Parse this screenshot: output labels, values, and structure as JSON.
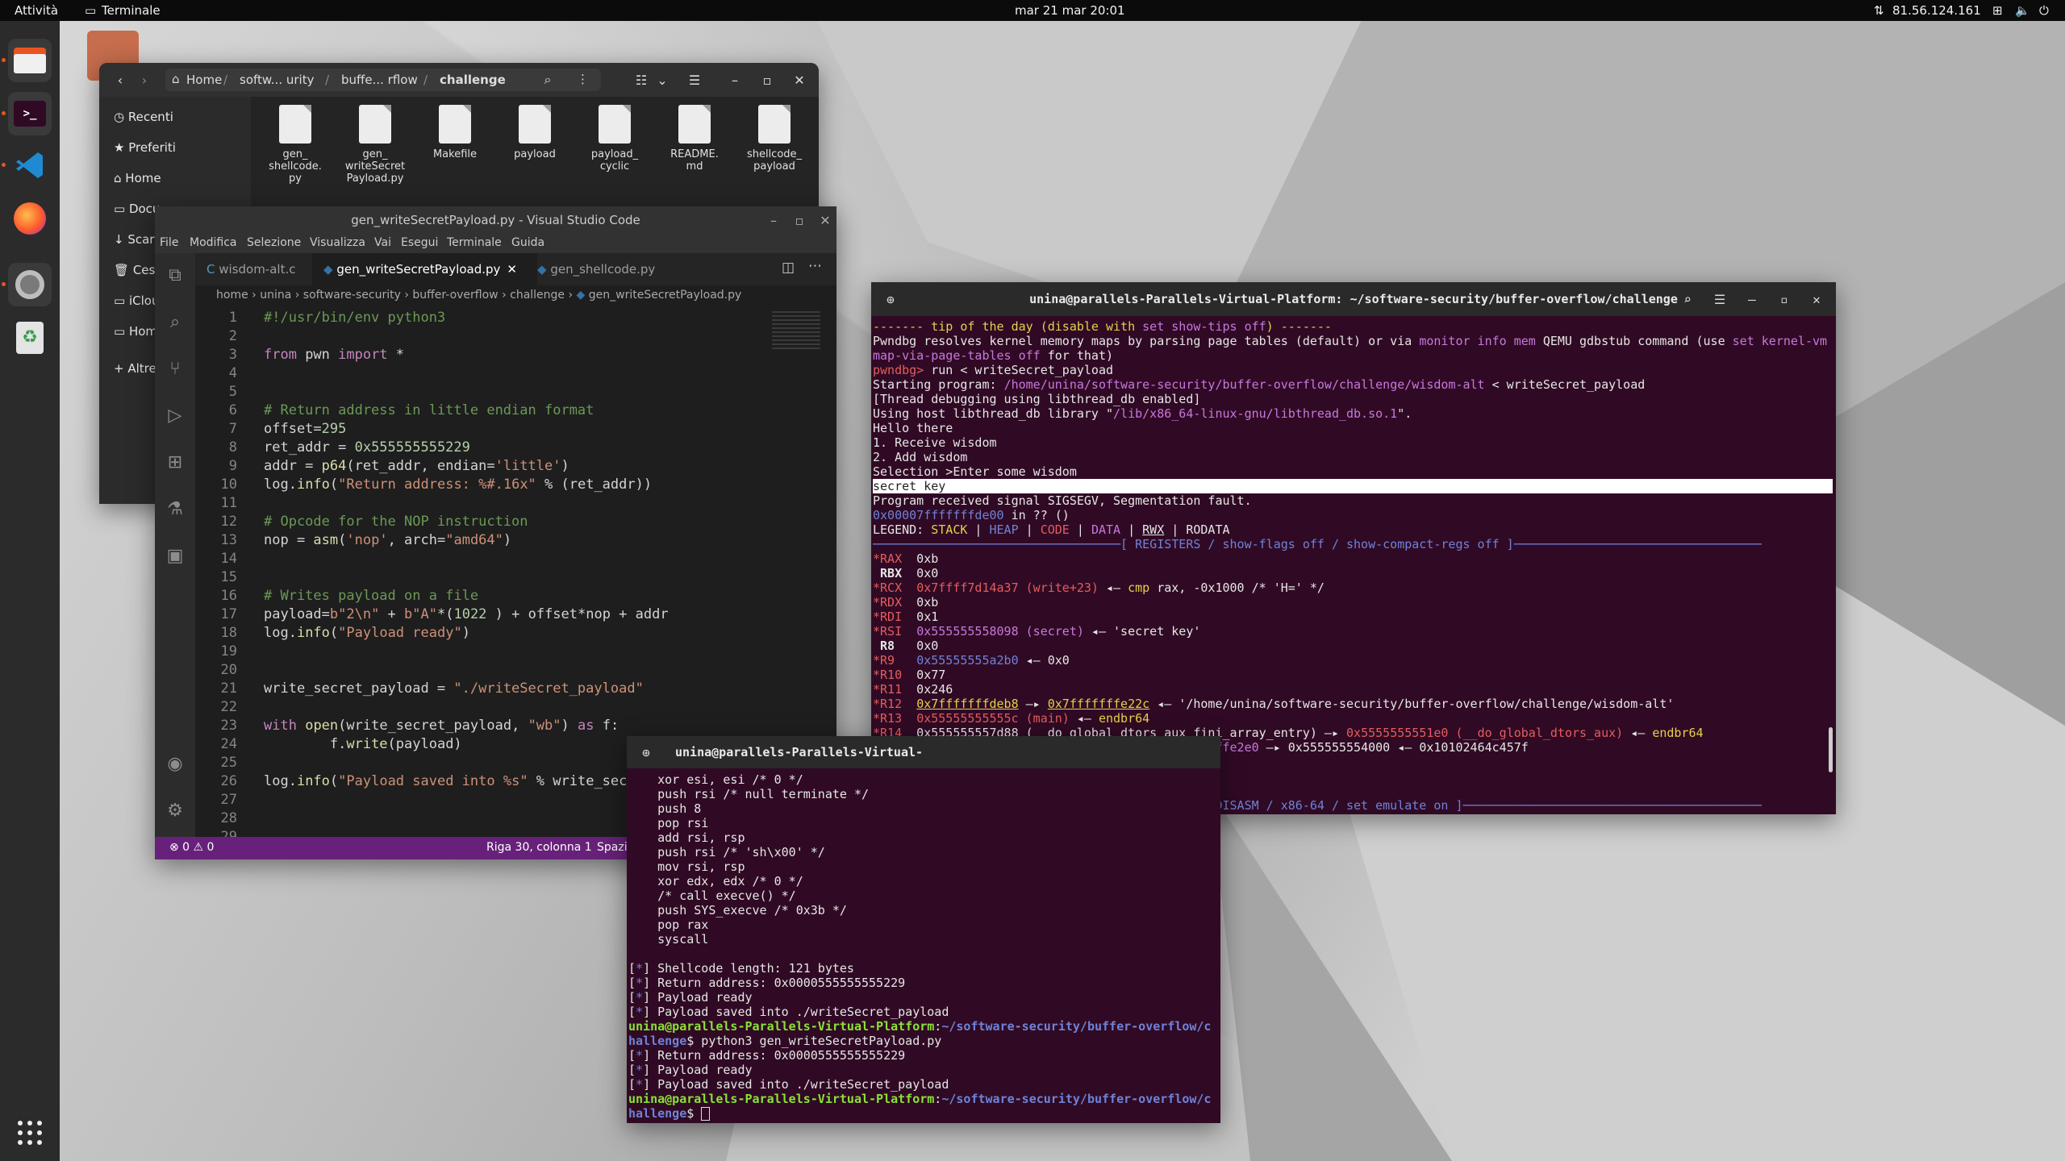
{
  "topbar": {
    "activities": "Attività",
    "app_name": "Terminale",
    "clock": "mar 21 mar  20:01",
    "ip": "81.56.124.161"
  },
  "files": {
    "breadcrumb": [
      "Home",
      "softw... urity",
      "buffe... rflow",
      "challenge"
    ],
    "sidebar": [
      "Recenti",
      "Preferiti",
      "Home",
      "Docu",
      "Scar",
      "Cest",
      "iClou",
      "Hom",
      "Altre"
    ],
    "items": [
      {
        "name": "gen_\nshellcode.\npy",
        "icon": "python-file-icon"
      },
      {
        "name": "gen_\nwriteSecret\nPayload.py",
        "icon": "python-file-icon"
      },
      {
        "name": "Makefile",
        "icon": "makefile-icon"
      },
      {
        "name": "payload",
        "icon": "text-file-icon"
      },
      {
        "name": "payload_\ncyclic",
        "icon": "text-file-icon"
      },
      {
        "name": "README.\nmd",
        "icon": "markdown-file-icon"
      },
      {
        "name": "shellcode_\npayload",
        "icon": "text-file-icon"
      }
    ]
  },
  "vscode": {
    "title": "gen_writeSecretPayload.py - Visual Studio Code",
    "menu": [
      "File",
      "Modifica",
      "Selezione",
      "Visualizza",
      "Vai",
      "Esegui",
      "Terminale",
      "Guida"
    ],
    "tabs": [
      "wisdom-alt.c",
      "gen_writeSecretPayload.py",
      "gen_shellcode.py"
    ],
    "breadcrumb": [
      "home",
      "unina",
      "software-security",
      "buffer-overflow",
      "challenge",
      "gen_writeSecretPayload.py"
    ],
    "status": {
      "problems": "⊗ 0 ⚠ 0",
      "position": "Riga 30, colonna 1",
      "spaces": "Spazi"
    }
  },
  "term_main": {
    "title": "unina@parallels-Parallels-Virtual-Platform: ~/software-security/buffer-overflow/challenge",
    "highlight": "secret key"
  },
  "term_small": {
    "title": "unina@parallels-Parallels-Virtual-"
  }
}
